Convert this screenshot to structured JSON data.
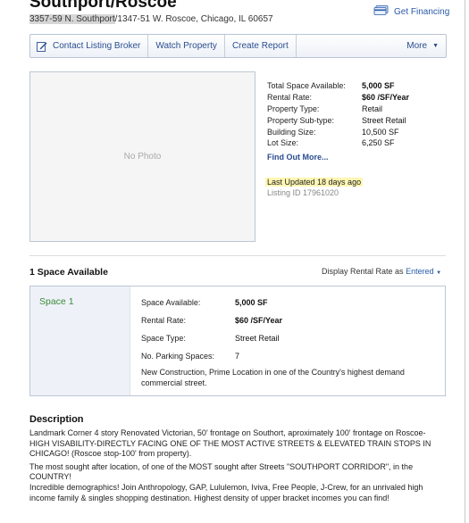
{
  "title": "Southport/Roscoe",
  "address": {
    "highlighted": "3357-59 N. Southport",
    "rest": "/1347-51 W. Roscoe, Chicago, IL 60657"
  },
  "financing_link": "Get Financing",
  "toolbar": {
    "contact": "Contact Listing Broker",
    "watch": "Watch Property",
    "report": "Create Report",
    "more": "More"
  },
  "photo_placeholder": "No Photo",
  "facts": [
    {
      "label": "Total Space Available:",
      "value": "5,000 SF",
      "bold": true
    },
    {
      "label": "Rental Rate:",
      "value": "$60 /SF/Year",
      "bold": true
    },
    {
      "label": "Property Type:",
      "value": "Retail",
      "bold": false
    },
    {
      "label": "Property Sub-type:",
      "value": "Street Retail",
      "bold": false
    },
    {
      "label": "Building Size:",
      "value": "10,500 SF",
      "bold": false
    },
    {
      "label": "Lot Size:",
      "value": "6,250 SF",
      "bold": false
    }
  ],
  "find_out_more": "Find Out More...",
  "last_updated": "Last Updated  18 days ago",
  "listing_id": "Listing ID  17961020",
  "spaces_header": "1 Space Available",
  "display_rate": {
    "prefix": "Display Rental Rate as",
    "value": "Entered"
  },
  "space": {
    "name": "Space 1",
    "rows": [
      {
        "label": "Space Available:",
        "value": "5,000 SF",
        "bold": true
      },
      {
        "label": "Rental Rate:",
        "value": "$60 /SF/Year",
        "bold": true
      },
      {
        "label": "Space Type:",
        "value": "Street Retail",
        "bold": false
      },
      {
        "label": "No. Parking Spaces:",
        "value": "7",
        "bold": false
      }
    ],
    "description": "New Construction, Prime Location in one of the Country's highest demand commercial street."
  },
  "description_header": "Description",
  "description": [
    "Landmark Corner 4 story Renovated Victorian, 50' frontage on Southort, aproximately 100' frontage on Roscoe-HIGH VISABILITY-DIRECTLY FACING ONE OF THE MOST ACTIVE STREETS & ELEVATED TRAIN STOPS IN CHICAGO! (Roscoe stop-100' from property).",
    "The most sought after location, of one of the MOST sought after Streets \"SOUTHPORT CORRIDOR\", in the COUNTRY!\nIncredible demographics! Join Anthropology, GAP, Lululemon, Iviva, Free People, J-Crew, for an unrivaled high income family & singles shopping destination. Highest density of upper bracket incomes you can find!"
  ],
  "colors": {
    "link": "#2a4d8f",
    "space_name": "#3a8a3a",
    "highlight": "#fff7b2"
  }
}
